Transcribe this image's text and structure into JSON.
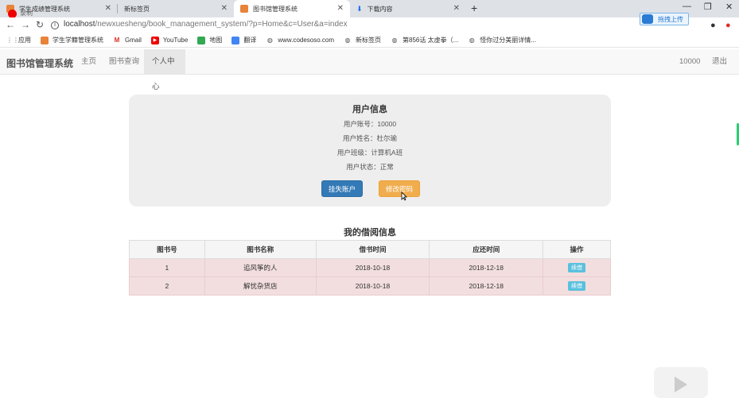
{
  "browser": {
    "tabs": [
      {
        "title": "学生成绩管理系统",
        "icon_color": "#e8833a"
      },
      {
        "title": "新标签页",
        "icon_color": ""
      },
      {
        "title": "图书馆管理系统",
        "icon_color": "#e8833a"
      },
      {
        "title": "下载内容",
        "icon_color": "#1a73e8"
      }
    ],
    "recording_label": "录制",
    "address": {
      "host": "localhost",
      "path": "/newxuesheng/book_management_system/?p=Home&c=User&a=index"
    },
    "upload_label": "拖拽上传",
    "bookmarks": [
      {
        "label": "应用",
        "icon": "apps-icon"
      },
      {
        "label": "学生学籍管理系统",
        "icon": "orange-page-icon"
      },
      {
        "label": "Gmail",
        "icon": "gmail-icon"
      },
      {
        "label": "YouTube",
        "icon": "youtube-icon"
      },
      {
        "label": "地图",
        "icon": "maps-icon"
      },
      {
        "label": "翻译",
        "icon": "translate-icon"
      },
      {
        "label": "www.codesoso.com",
        "icon": "globe-icon"
      },
      {
        "label": "新标签页",
        "icon": "globe-icon"
      },
      {
        "label": "第856话 太虚拳（...",
        "icon": "globe-icon"
      },
      {
        "label": "怪你过分美丽详情...",
        "icon": "globe-icon"
      }
    ]
  },
  "app": {
    "brand": "图书馆管理系统",
    "nav": [
      {
        "label": "主页"
      },
      {
        "label": "图书查询"
      },
      {
        "label": "个人中心"
      }
    ],
    "user_id": "10000",
    "logout": "退出"
  },
  "user_info": {
    "title": "用户信息",
    "account": "用户账号：10000",
    "name": "用户姓名：杜尔瑜",
    "class": "用户班级：计算机A班",
    "status": "用户状态：正常",
    "lost_button": "挂失账户",
    "password_button": "修改密码"
  },
  "borrow": {
    "title": "我的借阅信息",
    "columns": [
      "图书号",
      "图书名称",
      "借书时间",
      "应还时间",
      "操作"
    ],
    "rows": [
      {
        "id": "1",
        "name": "追风筝的人",
        "borrow_date": "2018-10-18",
        "due_date": "2018-12-18",
        "action": "续借"
      },
      {
        "id": "2",
        "name": "解忧杂货店",
        "borrow_date": "2018-10-18",
        "due_date": "2018-12-18",
        "action": "续借"
      }
    ]
  },
  "colors": {
    "primary": "#337ab7",
    "warning": "#f0ad4e",
    "danger_row": "#f2dede",
    "info": "#5bc0de"
  }
}
